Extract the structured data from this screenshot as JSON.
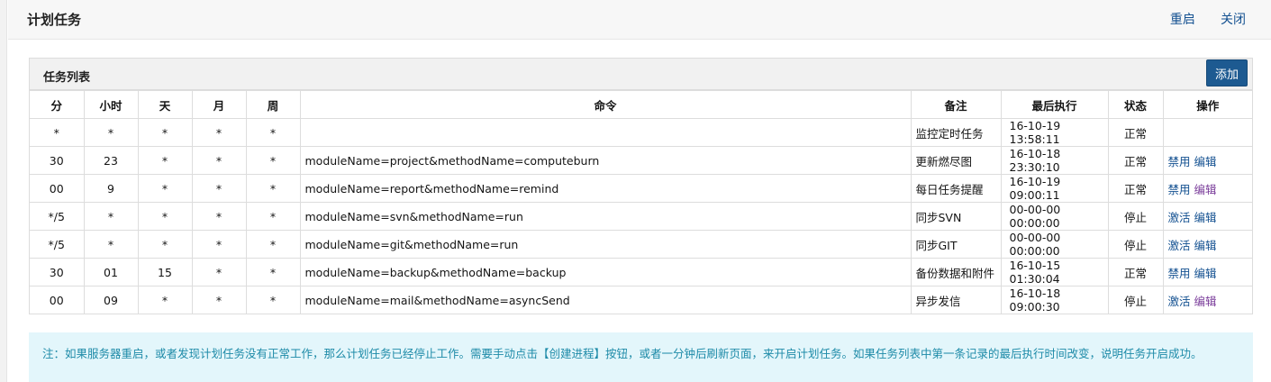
{
  "header": {
    "title": "计划任务",
    "restart_label": "重启",
    "close_label": "关闭"
  },
  "panel": {
    "title": "任务列表",
    "add_label": "添加"
  },
  "table": {
    "columns": [
      "分",
      "小时",
      "天",
      "月",
      "周",
      "命令",
      "备注",
      "最后执行",
      "状态",
      "操作"
    ],
    "rows": [
      {
        "min": "*",
        "hour": "*",
        "day": "*",
        "month": "*",
        "week": "*",
        "command": "",
        "remark": "监控定时任务",
        "last_run": "16-10-19 13:58:11",
        "status": "正常",
        "toggle": "",
        "edit": ""
      },
      {
        "min": "30",
        "hour": "23",
        "day": "*",
        "month": "*",
        "week": "*",
        "command": "moduleName=project&methodName=computeburn",
        "remark": "更新燃尽图",
        "last_run": "16-10-18 23:30:10",
        "status": "正常",
        "toggle": "禁用",
        "edit": "编辑"
      },
      {
        "min": "00",
        "hour": "9",
        "day": "*",
        "month": "*",
        "week": "*",
        "command": "moduleName=report&methodName=remind",
        "remark": "每日任务提醒",
        "last_run": "16-10-19 09:00:11",
        "status": "正常",
        "toggle": "禁用",
        "edit": "编辑"
      },
      {
        "min": "*/5",
        "hour": "*",
        "day": "*",
        "month": "*",
        "week": "*",
        "command": "moduleName=svn&methodName=run",
        "remark": "同步SVN",
        "last_run": "00-00-00 00:00:00",
        "status": "停止",
        "toggle": "激活",
        "edit": "编辑"
      },
      {
        "min": "*/5",
        "hour": "*",
        "day": "*",
        "month": "*",
        "week": "*",
        "command": "moduleName=git&methodName=run",
        "remark": "同步GIT",
        "last_run": "00-00-00 00:00:00",
        "status": "停止",
        "toggle": "激活",
        "edit": "编辑"
      },
      {
        "min": "30",
        "hour": "01",
        "day": "15",
        "month": "*",
        "week": "*",
        "command": "moduleName=backup&methodName=backup",
        "remark": "备份数据和附件",
        "last_run": "16-10-15 01:30:04",
        "status": "正常",
        "toggle": "禁用",
        "edit": "编辑"
      },
      {
        "min": "00",
        "hour": "09",
        "day": "*",
        "month": "*",
        "week": "*",
        "command": "moduleName=mail&methodName=asyncSend",
        "remark": "异步发信",
        "last_run": "16-10-18 09:00:30",
        "status": "停止",
        "toggle": "激活",
        "edit": "编辑"
      }
    ]
  },
  "note": {
    "text": "注：如果服务器重启，或者发现计划任务没有正常工作，那么计划任务已经停止工作。需要手动点击【创建进程】按钮，或者一分钟后刷新页面，来开启计划任务。如果任务列表中第一条记录的最后执行时间改变，说明任务开启成功。"
  },
  "colors": {
    "accent": "#1d5a91",
    "link": "#145191",
    "note_bg": "#e3f6fb",
    "note_text": "#1e8ba8"
  }
}
